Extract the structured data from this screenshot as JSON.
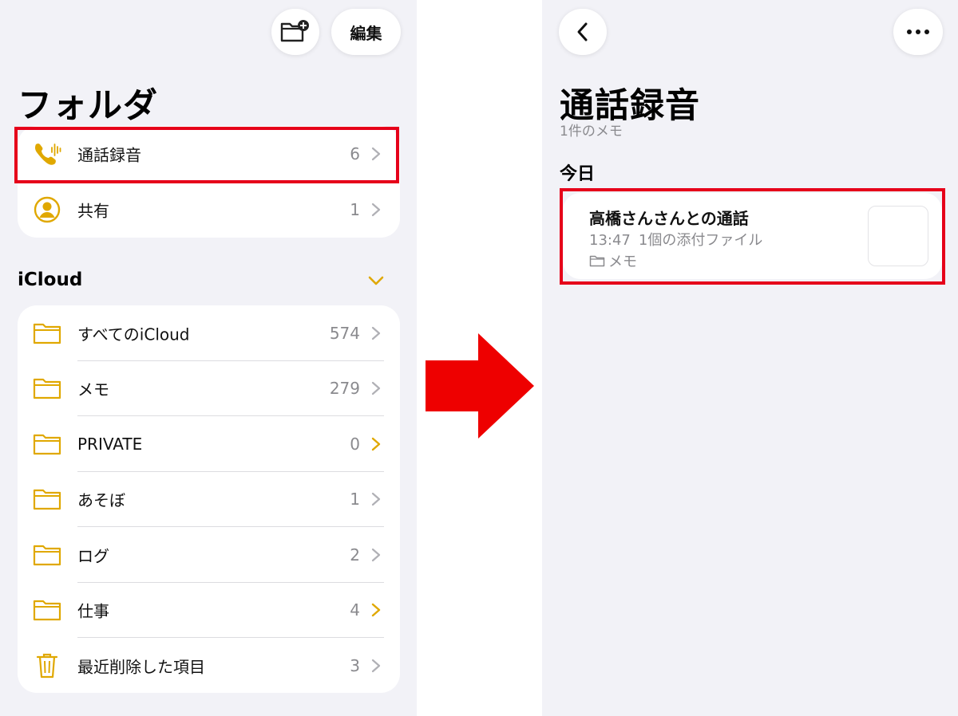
{
  "left_screen": {
    "toolbar": {
      "edit_label": "編集"
    },
    "title": "フォルダ",
    "top_folders": [
      {
        "label": "通話録音",
        "count": "6",
        "icon": "phone-waveform-icon"
      },
      {
        "label": "共有",
        "count": "1",
        "icon": "person-circle-icon"
      }
    ],
    "icloud_section": {
      "header": "iCloud",
      "folders": [
        {
          "label": "すべてのiCloud",
          "count": "574",
          "icon": "folder-icon"
        },
        {
          "label": "メモ",
          "count": "279",
          "icon": "folder-icon"
        },
        {
          "label": "PRIVATE",
          "count": "0",
          "icon": "folder-icon"
        },
        {
          "label": "あそぼ",
          "count": "1",
          "icon": "folder-icon"
        },
        {
          "label": "ログ",
          "count": "2",
          "icon": "folder-icon"
        },
        {
          "label": "仕事",
          "count": "4",
          "icon": "folder-icon"
        },
        {
          "label": "最近削除した項目",
          "count": "3",
          "icon": "trash-icon"
        }
      ]
    }
  },
  "right_screen": {
    "title": "通話録音",
    "subtitle": "1件のメモ",
    "section_header": "今日",
    "note": {
      "title": "高橋さんさんとの通話",
      "time": "13:47",
      "attachment": "1個の添付ファイル",
      "folder": "メモ"
    }
  },
  "colors": {
    "accent": "#e0a800",
    "highlight": "#e6001a",
    "arrow": "#ee0000",
    "background": "#f2f2f7"
  }
}
